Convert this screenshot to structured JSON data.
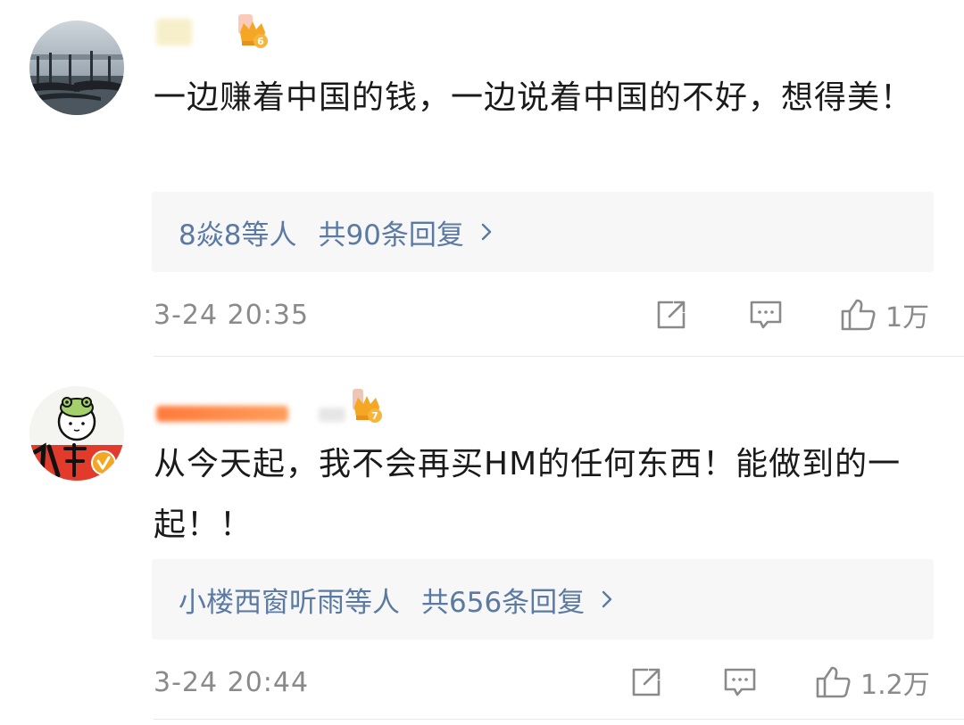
{
  "comments": [
    {
      "badge_level": "6",
      "text": "一边赚着中国的钱，一边说着中国的不好，想得美！",
      "replies": {
        "users": "8焱8等人",
        "total": "共90条回复"
      },
      "timestamp": "3-24 20:35",
      "actions": {
        "share_icon": "share-icon",
        "comment_icon": "comment-icon",
        "like_icon": "thumbs-up-icon",
        "like_count": "1万"
      }
    },
    {
      "badge_level": "7",
      "text": "从今天起，我不会再买HM的任何东西！能做到的一起！！",
      "replies": {
        "users": "小楼西窗听雨等人",
        "total": "共656条回复"
      },
      "timestamp": "3-24 20:44",
      "actions": {
        "share_icon": "share-icon",
        "comment_icon": "comment-icon",
        "like_icon": "thumbs-up-icon",
        "like_count": "1.2万"
      }
    }
  ],
  "colors": {
    "link": "#5b7aa3",
    "meta": "#8a8a8a",
    "text": "#1a1a1a",
    "badge": "#f5a623"
  }
}
